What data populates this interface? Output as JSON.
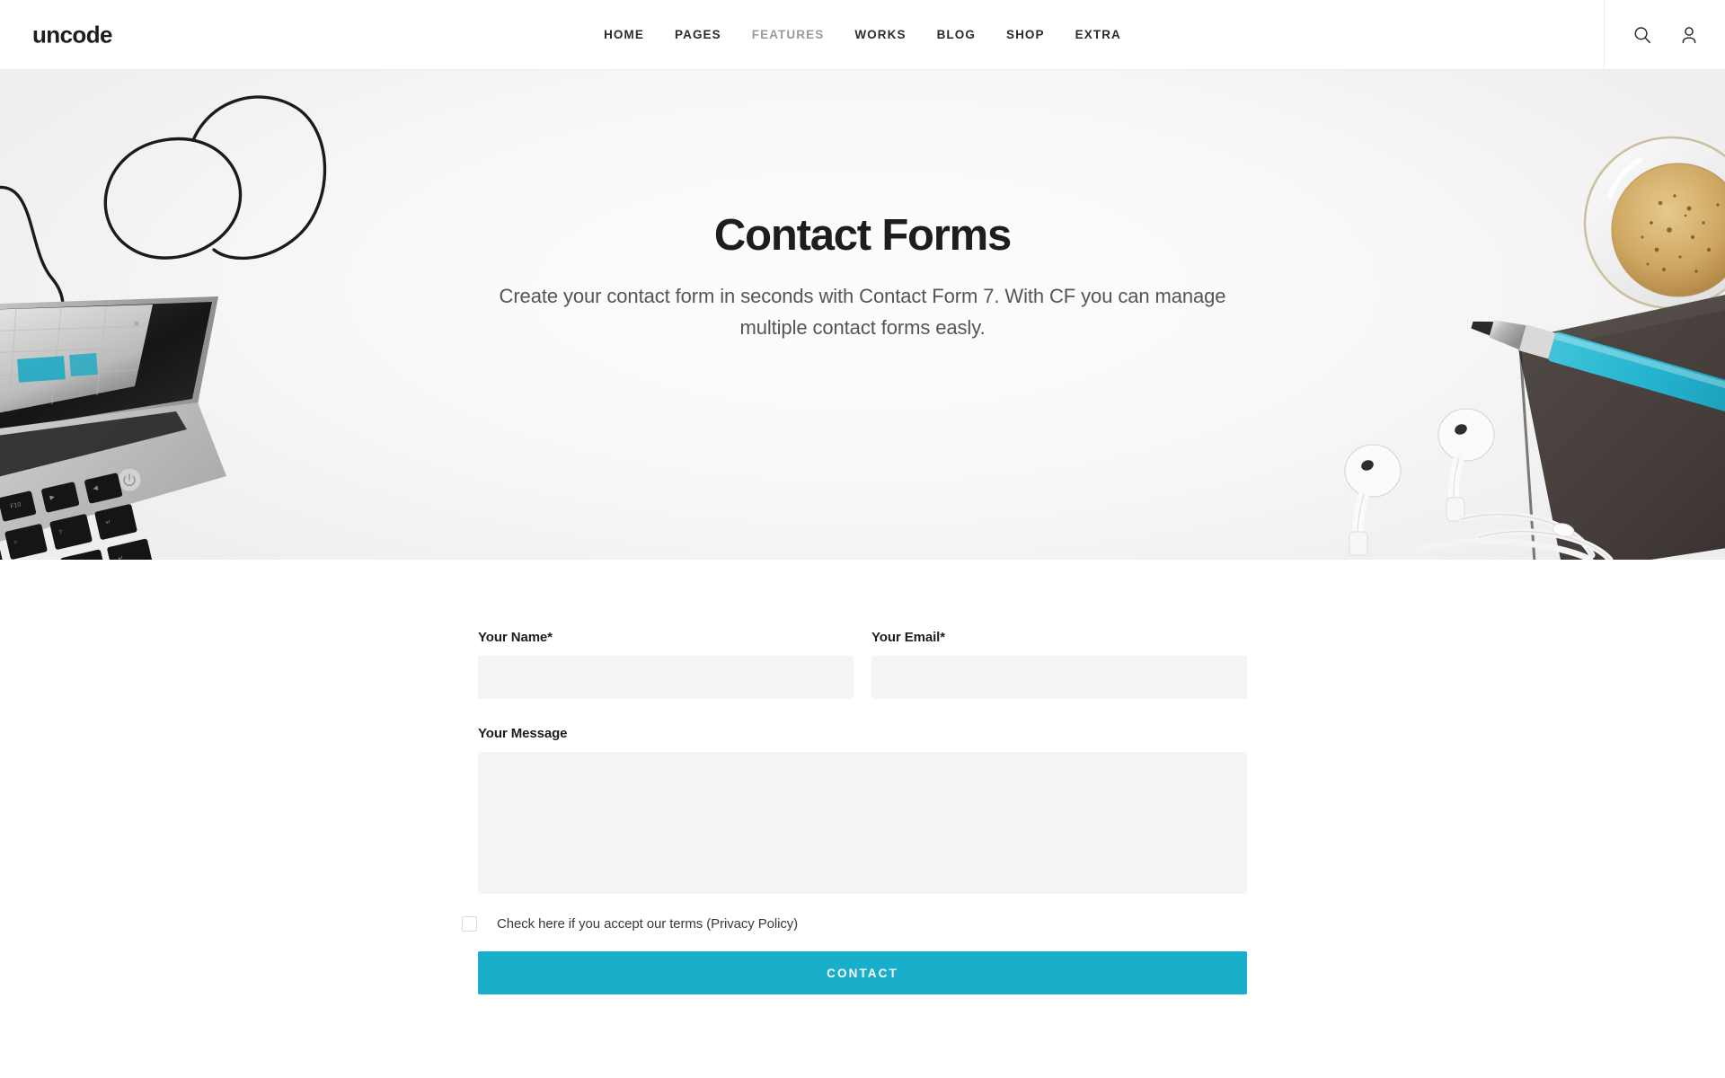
{
  "header": {
    "logo": "uncode",
    "nav": [
      {
        "label": "HOME",
        "active": false
      },
      {
        "label": "PAGES",
        "active": false
      },
      {
        "label": "FEATURES",
        "active": true
      },
      {
        "label": "WORKS",
        "active": false
      },
      {
        "label": "BLOG",
        "active": false
      },
      {
        "label": "SHOP",
        "active": false
      },
      {
        "label": "EXTRA",
        "active": false
      }
    ],
    "tools": [
      {
        "icon": "search-icon"
      },
      {
        "icon": "user-icon"
      }
    ]
  },
  "hero": {
    "title": "Contact Forms",
    "subtitle": "Create your contact form in seconds with Contact Form 7. With CF you can manage multiple contact forms easly."
  },
  "form": {
    "name": {
      "label": "Your Name*",
      "value": "",
      "placeholder": ""
    },
    "email": {
      "label": "Your Email*",
      "value": "",
      "placeholder": ""
    },
    "message": {
      "label": "Your Message",
      "value": "",
      "placeholder": ""
    },
    "accept": {
      "text": "Check here if you accept our terms (Privacy Policy)",
      "checked": false
    },
    "submit_label": "CONTACT"
  },
  "colors": {
    "accent": "#19afcb",
    "text": "#1d1d1d",
    "muted": "#9a9a9a",
    "field_bg": "#f5f5f5",
    "hero_bg": "#f5f5f5",
    "pencil_teal": "#25b4d0"
  }
}
